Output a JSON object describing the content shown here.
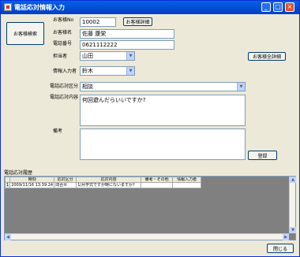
{
  "window": {
    "title": "電話応対情報入力",
    "minimize_glyph": "_",
    "maximize_glyph": "□",
    "close_glyph": "×"
  },
  "customer_search_button": "お客様検索",
  "customer_no": {
    "label": "お客様No",
    "value": "10002"
  },
  "customer_detail_button": "お客様詳細",
  "customer_name": {
    "label": "お客様名",
    "value": "佐藤 康栄"
  },
  "phone": {
    "label": "電話番号",
    "value": "0621112222"
  },
  "staff": {
    "label": "担当者",
    "value": "山田"
  },
  "all_customer_detail_button": "お客様全詳細",
  "entry_person": {
    "label": "情報入力者",
    "value": "鈴木"
  },
  "call_category": {
    "label": "電話応対区分",
    "value": "相談"
  },
  "call_content": {
    "label": "電話応対内容",
    "value": "何回遊んだらいいですか?"
  },
  "remarks": {
    "label": "備考",
    "value": ""
  },
  "register_button": "登録",
  "history": {
    "label": "電話応対履歴",
    "columns": [
      "",
      "時刻",
      "応対区分",
      "応対内容",
      "備考・その他",
      "情報入力者"
    ],
    "rows": [
      [
        "1",
        "2009/11/16 13:39:24",
        "問合せ",
        "1/月学式ですが時にないますか?",
        "",
        ""
      ]
    ]
  },
  "close_button": "閉じる",
  "colors": {
    "title_bar": "#0254d8",
    "window_bg": "#ece9d8",
    "close_button": "#e0542f",
    "grid_bg": "#808080"
  }
}
